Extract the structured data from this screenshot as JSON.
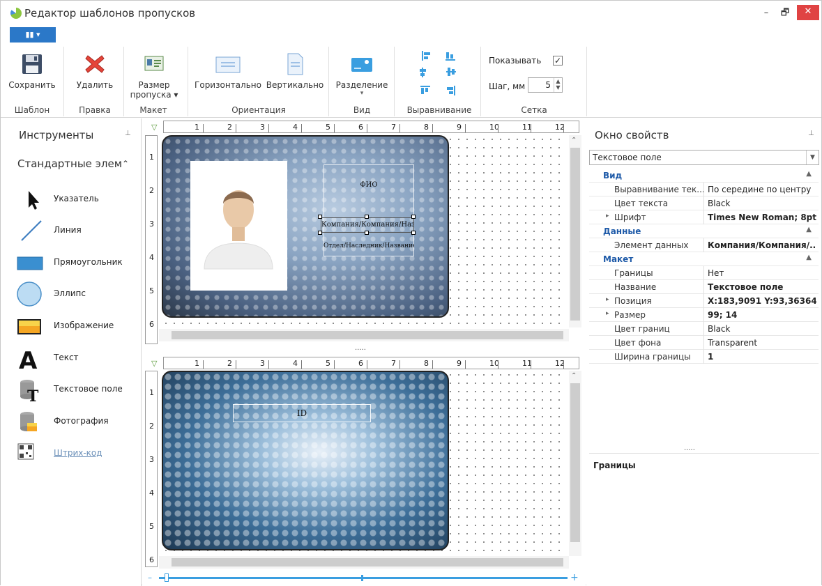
{
  "window": {
    "title": "Редактор шаблонов пропусков",
    "minimize": "–",
    "restore": "🗗",
    "close": "✕"
  },
  "app_menu": {
    "label": "▮▮ ▾"
  },
  "ribbon": {
    "buttons": {
      "save": "Сохранить",
      "delete": "Удалить",
      "size": "Размер",
      "size2": "пропуска ▾",
      "horizontal": "Горизонтально",
      "vertical": "Вертикально",
      "split": "Разделение",
      "split_arrow": "▾"
    },
    "groups": {
      "template": "Шаблон",
      "edit": "Правка",
      "layout": "Макет",
      "orientation": "Ориентация",
      "view": "Вид",
      "align": "Выравнивание",
      "grid": "Сетка"
    },
    "grid": {
      "show_label": "Показывать",
      "show_checked": true,
      "step_label": "Шаг, мм",
      "step_value": "5"
    }
  },
  "tools_panel": {
    "title": "Инструменты",
    "pin": "⊥",
    "section": "Стандартные элем",
    "section_chevron": "⌃",
    "items": [
      {
        "label": "Указатель",
        "icon": "pointer-icon"
      },
      {
        "label": "Линия",
        "icon": "line-icon"
      },
      {
        "label": "Прямоугольник",
        "icon": "rectangle-icon"
      },
      {
        "label": "Эллипс",
        "icon": "ellipse-icon"
      },
      {
        "label": "Изображение",
        "icon": "image-icon"
      },
      {
        "label": "Текст",
        "icon": "text-icon"
      },
      {
        "label": "Текстовое поле",
        "icon": "database-text-icon"
      },
      {
        "label": "Фотография",
        "icon": "database-photo-icon"
      },
      {
        "label": "Штрих-код",
        "icon": "qr-code-icon"
      }
    ]
  },
  "canvas": {
    "ruler_h": [
      "1",
      "2",
      "3",
      "4",
      "5",
      "6",
      "7",
      "8",
      "9",
      "10",
      "11",
      "12"
    ],
    "ruler_v_front": [
      "1",
      "2",
      "3",
      "4",
      "5",
      "6"
    ],
    "ruler_v_back": [
      "1",
      "2",
      "3",
      "4",
      "5",
      "6"
    ],
    "front": {
      "fio": "ФИО",
      "company": "Компания/Компания/Название",
      "department": "Отдел/Наследник/Название"
    },
    "back": {
      "id": "ID"
    },
    "splitter": "....."
  },
  "props_panel": {
    "title": "Окно свойств",
    "pin": "⊥",
    "selector": "Текстовое поле",
    "categories": [
      {
        "name": "Вид",
        "rows": [
          {
            "k": "Выравнивание тек...",
            "v": "По середине по центру",
            "bold": false,
            "exp": ""
          },
          {
            "k": "Цвет текста",
            "v": "Black",
            "bold": false,
            "exp": ""
          },
          {
            "k": "Шрифт",
            "v": "Times New Roman; 8pt",
            "bold": true,
            "exp": "▸"
          }
        ]
      },
      {
        "name": "Данные",
        "rows": [
          {
            "k": "Элемент данных",
            "v": "Компания/Компания/...",
            "bold": true,
            "exp": ""
          }
        ]
      },
      {
        "name": "Макет",
        "rows": [
          {
            "k": "Границы",
            "v": "Нет",
            "bold": false,
            "exp": ""
          },
          {
            "k": "Название",
            "v": "Текстовое поле",
            "bold": true,
            "exp": ""
          },
          {
            "k": "Позиция",
            "v": "X:183,9091 Y:93,36364",
            "bold": true,
            "exp": "▸"
          },
          {
            "k": "Размер",
            "v": "99; 14",
            "bold": true,
            "exp": "▸"
          },
          {
            "k": "Цвет границ",
            "v": "Black",
            "bold": false,
            "exp": ""
          },
          {
            "k": "Цвет фона",
            "v": "Transparent",
            "bold": false,
            "exp": ""
          },
          {
            "k": "Ширина границы",
            "v": "1",
            "bold": true,
            "exp": ""
          }
        ]
      }
    ],
    "splitter": ".....",
    "description_title": "Границы"
  },
  "colors": {
    "accent": "#2b78c8",
    "category": "#1e5aa8",
    "close": "#e04343"
  }
}
